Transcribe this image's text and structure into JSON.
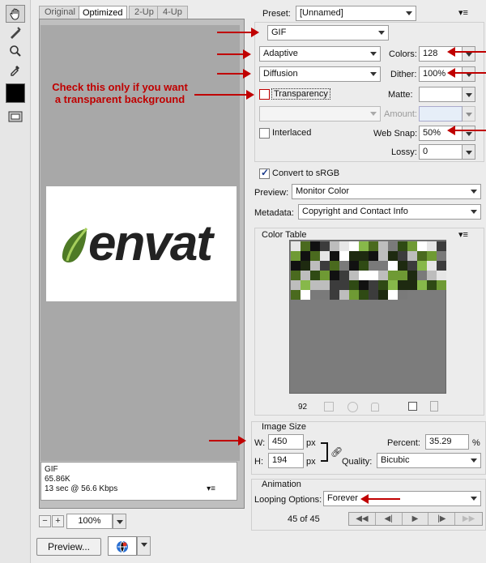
{
  "tabs": [
    {
      "label": "Original"
    },
    {
      "label": "Optimized"
    },
    {
      "label": "2-Up"
    },
    {
      "label": "4-Up"
    }
  ],
  "annotation_note": "Check this only if you want\na transparent background",
  "preview": {
    "logo_text": "envat",
    "info_format": "GIF",
    "info_size": "65.86K",
    "info_time": "13 sec @ 56.6 Kbps",
    "zoom": "100%",
    "preview_button": "Preview..."
  },
  "settings": {
    "preset_label": "Preset:",
    "preset_value": "[Unnamed]",
    "format_value": "GIF",
    "reduction_value": "Adaptive",
    "dither_algo_value": "Diffusion",
    "colors_label": "Colors:",
    "colors_value": "128",
    "dither_label": "Dither:",
    "dither_value": "100%",
    "transparency_label": "Transparency",
    "transparency_checked": false,
    "matte_label": "Matte:",
    "matte_value": "",
    "amount_label": "Amount:",
    "amount_value": "",
    "interlaced_label": "Interlaced",
    "interlaced_checked": false,
    "websnap_label": "Web Snap:",
    "websnap_value": "50%",
    "lossy_label": "Lossy:",
    "lossy_value": "0",
    "convert_label": "Convert to sRGB",
    "convert_checked": true,
    "preview_label": "Preview:",
    "preview_value": "Monitor Color",
    "metadata_label": "Metadata:",
    "metadata_value": "Copyright and Contact Info"
  },
  "color_table": {
    "title": "Color Table",
    "count": "92"
  },
  "image_size": {
    "title": "Image Size",
    "w_label": "W:",
    "w_value": "450",
    "h_label": "H:",
    "h_value": "194",
    "unit": "px",
    "percent_label": "Percent:",
    "percent_value": "35.29",
    "percent_unit": "%",
    "quality_label": "Quality:",
    "quality_value": "Bicubic"
  },
  "animation": {
    "title": "Animation",
    "looping_label": "Looping Options:",
    "looping_value": "Forever",
    "frame_counter": "45 of 45"
  },
  "colors": {
    "accent_red": "#c00000",
    "swatch_greens": [
      "#4a6a1e",
      "#6f9a34",
      "#2f4a14",
      "#87b84a",
      "#1e2a10"
    ]
  }
}
